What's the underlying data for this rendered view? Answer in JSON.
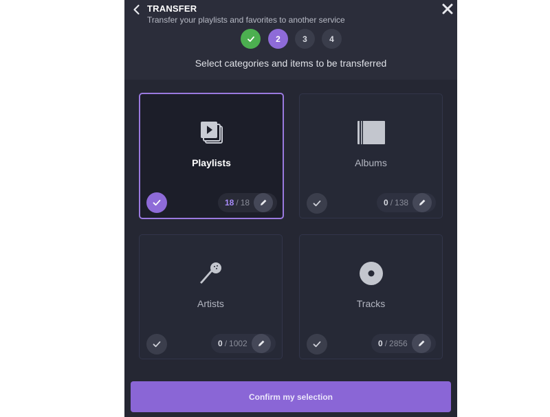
{
  "header": {
    "title": "TRANSFER",
    "subtitle": "Transfer your playlists and favorites to another service"
  },
  "steps": [
    {
      "label": "",
      "state": "done"
    },
    {
      "label": "2",
      "state": "active"
    },
    {
      "label": "3",
      "state": "pending"
    },
    {
      "label": "4",
      "state": "pending"
    }
  ],
  "instruction": "Select categories and items to be transferred",
  "categories": [
    {
      "label": "Playlists",
      "icon": "playlist-icon",
      "selected_count": "18",
      "separator": "/",
      "total": "18",
      "selected": true
    },
    {
      "label": "Albums",
      "icon": "album-icon",
      "selected_count": "0",
      "separator": "/",
      "total": "138",
      "selected": false
    },
    {
      "label": "Artists",
      "icon": "microphone-icon",
      "selected_count": "0",
      "separator": "/",
      "total": "1002",
      "selected": false
    },
    {
      "label": "Tracks",
      "icon": "disc-icon",
      "selected_count": "0",
      "separator": "/",
      "total": "2856",
      "selected": false
    }
  ],
  "confirm_label": "Confirm my selection",
  "colors": {
    "accent": "#8e6bd8",
    "success": "#4caf50",
    "panel_bg": "#252733"
  }
}
